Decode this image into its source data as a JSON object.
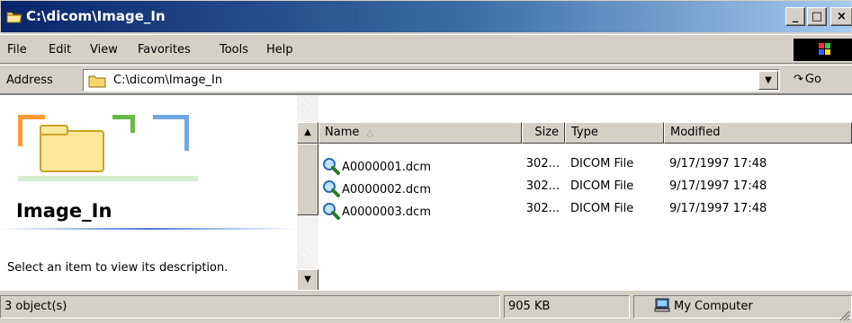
{
  "window": {
    "title": "C:\\dicom\\Image_In",
    "min_label": "_",
    "max_label": "□",
    "close_label": "×"
  },
  "menu": {
    "items": [
      {
        "label": "File"
      },
      {
        "label": "Edit"
      },
      {
        "label": "View"
      },
      {
        "label": "Favorites"
      },
      {
        "label": "Tools"
      },
      {
        "label": "Help"
      }
    ]
  },
  "address": {
    "label": "Address",
    "value": "C:\\dicom\\Image_In",
    "go_label": "Go"
  },
  "left_pane": {
    "folder_name": "Image_In",
    "description": "Select an item to view its description."
  },
  "file_list": {
    "columns": {
      "name": "Name",
      "size": "Size",
      "type": "Type",
      "modified": "Modified"
    },
    "sort_indicator": "△",
    "rows": [
      {
        "name": "A0000001.dcm",
        "size": "302...",
        "type": "DICOM File",
        "modified": "9/17/1997 17:48"
      },
      {
        "name": "A0000002.dcm",
        "size": "302...",
        "type": "DICOM File",
        "modified": "9/17/1997 17:48"
      },
      {
        "name": "A0000003.dcm",
        "size": "302...",
        "type": "DICOM File",
        "modified": "9/17/1997 17:48"
      }
    ]
  },
  "status": {
    "objects": "3 object(s)",
    "total_size": "905 KB",
    "zone": "My Computer"
  },
  "colors": {
    "title_start": "#0a246a",
    "title_end": "#a6caf0",
    "chrome": "#d4d0c8"
  }
}
